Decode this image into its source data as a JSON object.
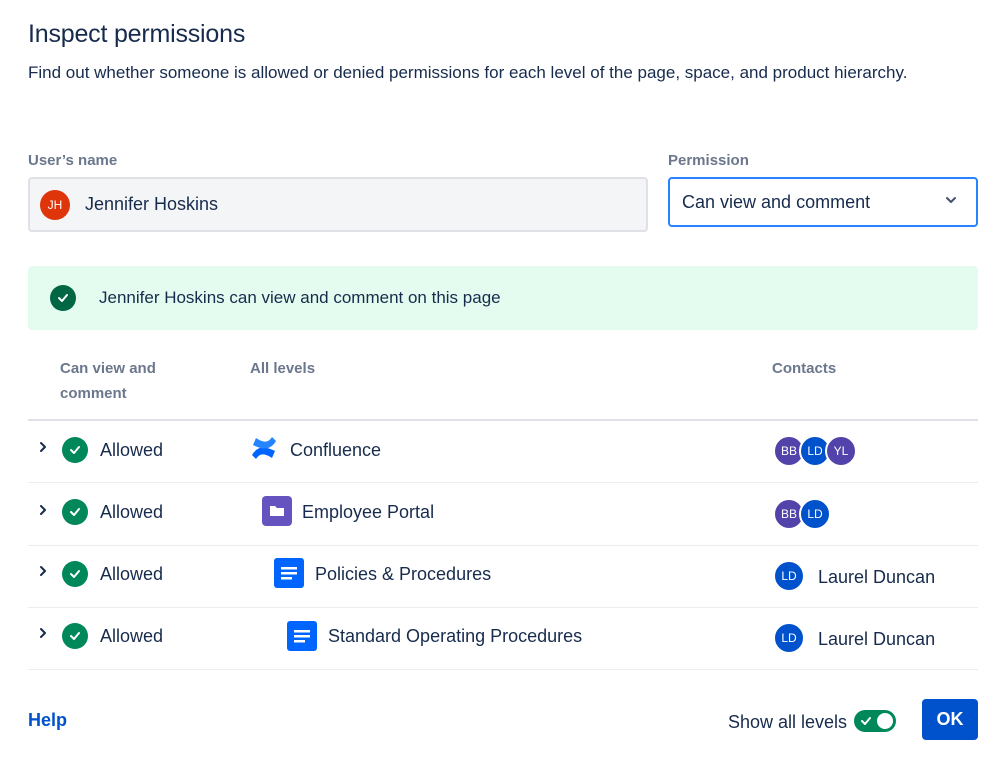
{
  "dialog": {
    "title": "Inspect permissions",
    "description": "Find out whether someone is allowed or denied permissions for each level of the page, space, and product hierarchy."
  },
  "user_field": {
    "label": "User’s name",
    "avatar_initials": "JH",
    "value": "Jennifer Hoskins"
  },
  "permission_field": {
    "label": "Permission",
    "value": "Can view and comment"
  },
  "banner": {
    "message": "Jennifer Hoskins can view and comment on this page"
  },
  "table": {
    "headers": {
      "permission": "Can view and comment",
      "levels": "All levels",
      "contacts": "Contacts"
    },
    "rows": [
      {
        "status": "Allowed",
        "level": "Confluence",
        "level_icon": "confluence-logo-icon",
        "contacts": [
          "BB",
          "LD",
          "YL"
        ],
        "contact_name": ""
      },
      {
        "status": "Allowed",
        "level": "Employee Portal",
        "level_icon": "space-folder-icon",
        "contacts": [
          "BB",
          "LD"
        ],
        "contact_name": ""
      },
      {
        "status": "Allowed",
        "level": "Policies & Procedures",
        "level_icon": "page-icon",
        "contacts": [
          "LD"
        ],
        "contact_name": "Laurel Duncan"
      },
      {
        "status": "Allowed",
        "level": "Standard Operating Procedures",
        "level_icon": "page-icon",
        "contacts": [
          "LD"
        ],
        "contact_name": "Laurel Duncan"
      }
    ]
  },
  "footer": {
    "help_label": "Help",
    "show_all_levels_label": "Show all levels",
    "show_all_levels_on": true,
    "ok_label": "OK"
  },
  "colors": {
    "primary": "#0052cc",
    "success": "#00875a",
    "success_bg": "#e3fcef",
    "avatar_purple": "#5243aa",
    "avatar_blue": "#0052cc",
    "avatar_red": "#de350b"
  }
}
